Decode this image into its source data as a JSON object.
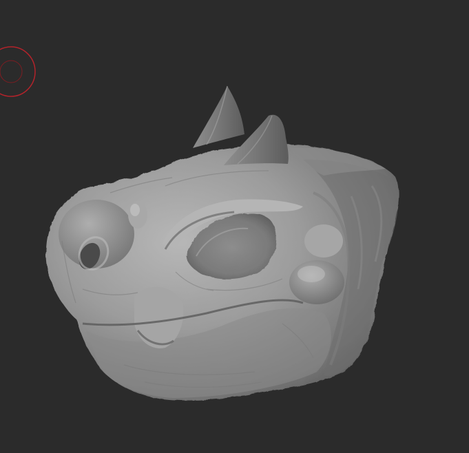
{
  "viewport": {
    "background": "#2b2b2b",
    "model_color": "#9a9a9a",
    "brush_color": "#c0262e",
    "subject": "dragon-head-sculpt"
  },
  "icons": {
    "brush_cursor": "brush-radius-cursor-icon"
  }
}
